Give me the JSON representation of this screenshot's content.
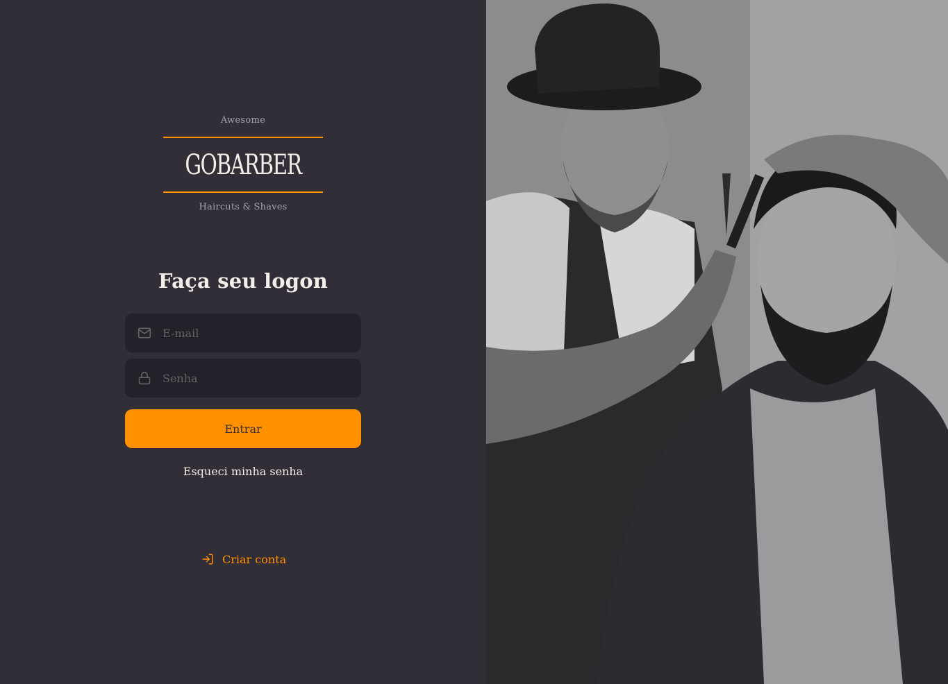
{
  "logo": {
    "top_text": "Awesome",
    "name": "GOBARBER",
    "bottom_text": "Haircuts & Shaves"
  },
  "form": {
    "title": "Faça seu logon",
    "email_placeholder": "E-mail",
    "password_placeholder": "Senha",
    "submit_label": "Entrar",
    "forgot_label": "Esqueci minha senha"
  },
  "signup": {
    "label": "Criar conta"
  },
  "colors": {
    "background": "#312e38",
    "input_bg": "#232129",
    "accent": "#ff9000",
    "text": "#f4ede8",
    "placeholder": "#666360"
  },
  "icons": {
    "email": "mail-icon",
    "password": "lock-icon",
    "signup": "log-in-icon"
  }
}
